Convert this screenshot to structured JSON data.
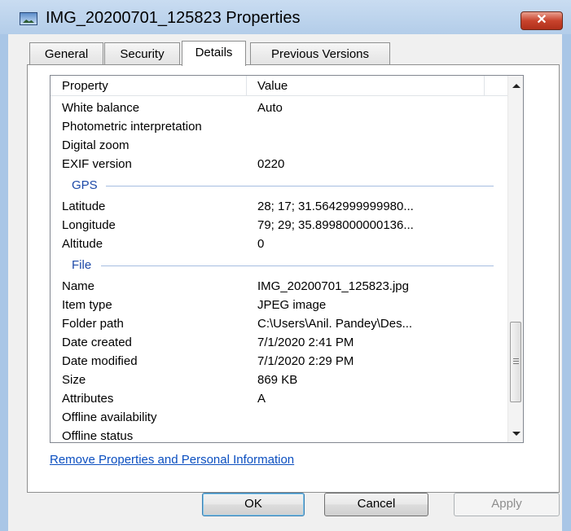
{
  "window": {
    "title": "IMG_20200701_125823 Properties",
    "close_glyph": "✕"
  },
  "tabs": [
    {
      "label": "General"
    },
    {
      "label": "Security"
    },
    {
      "label": "Details"
    },
    {
      "label": "Previous Versions"
    }
  ],
  "details": {
    "columns": {
      "property": "Property",
      "value": "Value"
    },
    "rows_top": [
      {
        "property": "White balance",
        "value": "Auto"
      },
      {
        "property": "Photometric interpretation",
        "value": ""
      },
      {
        "property": "Digital zoom",
        "value": ""
      },
      {
        "property": "EXIF version",
        "value": "0220"
      }
    ],
    "gps_group": "GPS",
    "rows_gps": [
      {
        "property": "Latitude",
        "value": "28; 17; 31.5642999999980..."
      },
      {
        "property": "Longitude",
        "value": "79; 29; 35.8998000000136..."
      },
      {
        "property": "Altitude",
        "value": "0"
      }
    ],
    "file_group": "File",
    "rows_file": [
      {
        "property": "Name",
        "value": "IMG_20200701_125823.jpg"
      },
      {
        "property": "Item type",
        "value": "JPEG image"
      },
      {
        "property": "Folder path",
        "value": "C:\\Users\\Anil. Pandey\\Des..."
      },
      {
        "property": "Date created",
        "value": "7/1/2020 2:41 PM"
      },
      {
        "property": "Date modified",
        "value": "7/1/2020 2:29 PM"
      },
      {
        "property": "Size",
        "value": "869 KB"
      },
      {
        "property": "Attributes",
        "value": "A"
      },
      {
        "property": "Offline availability",
        "value": ""
      },
      {
        "property": "Offline status",
        "value": ""
      }
    ]
  },
  "remove_link": "Remove Properties and Personal Information",
  "buttons": {
    "ok": "OK",
    "cancel": "Cancel",
    "apply": "Apply"
  }
}
